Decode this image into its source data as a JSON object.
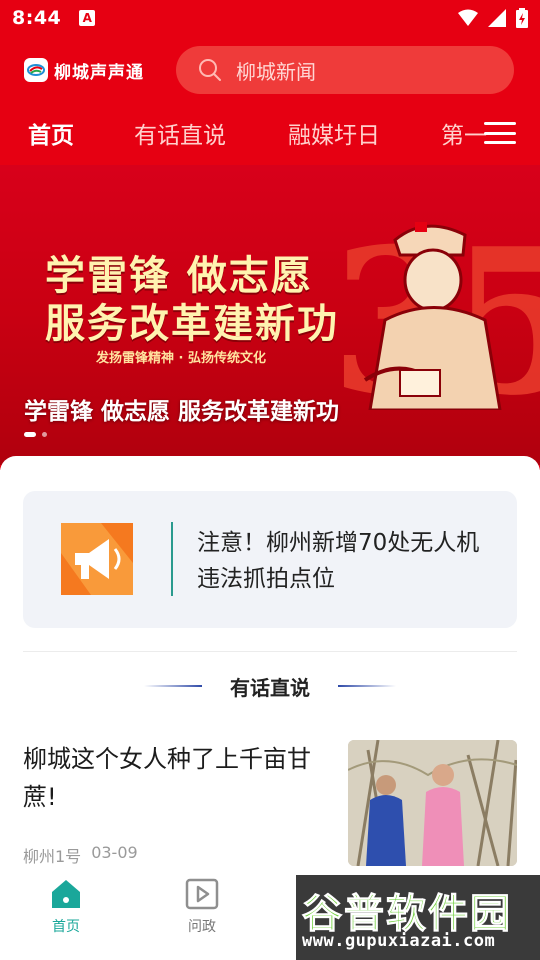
{
  "status_bar": {
    "time": "8:44",
    "notification_icon": "A"
  },
  "app_bar": {
    "app_name": "柳城声声通",
    "search_placeholder": "柳城新闻"
  },
  "tabs": [
    {
      "label": "首页",
      "active": true
    },
    {
      "label": "有话直说",
      "active": false
    },
    {
      "label": "融媒圩日",
      "active": false
    },
    {
      "label": "第一",
      "active": false
    }
  ],
  "banner": {
    "headline_line1": "学雷锋 做志愿",
    "headline_line2": "服务改革建新功",
    "slogan": "发扬雷锋精神 · 弘扬传统文化",
    "caption": "学雷锋 做志愿 服务改革建新功",
    "decor_number": "35",
    "slide_count": 2,
    "active_slide": 1
  },
  "notice": {
    "icon": "megaphone-icon",
    "text": "注意！柳州新增70处无人机违法抓拍点位"
  },
  "section": {
    "title": "有话直说"
  },
  "article": {
    "title": "柳城这个女人种了上千亩甘蔗!",
    "source": "柳州1号",
    "date": "03-09"
  },
  "bottom_nav": [
    {
      "label": "首页",
      "icon": "home-icon",
      "active": true
    },
    {
      "label": "问政",
      "icon": "play-square-icon",
      "active": false
    }
  ],
  "watermark": {
    "title": "谷普软件园",
    "url": "www.gupuxiazai.com"
  },
  "colors": {
    "brand_red": "#e60012",
    "accent_teal": "#1aa79a",
    "notice_orange": "#f5791f"
  }
}
